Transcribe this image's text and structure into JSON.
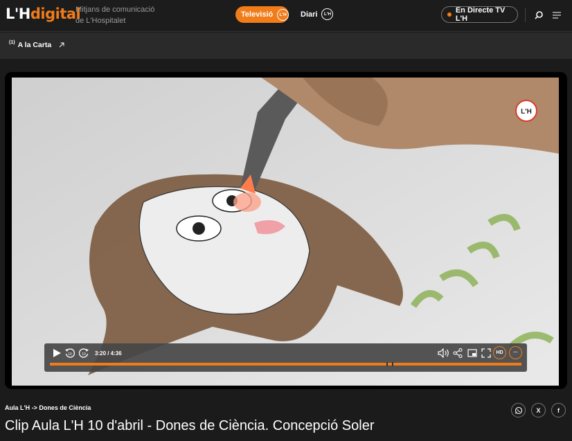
{
  "header": {
    "logo_lh": "L'H",
    "logo_digital": "digital",
    "tagline_line1": "Mitjans de comunicació",
    "tagline_line2": "de L'Hospitalet",
    "tv_label": "Televisió",
    "tv_badge": "L'H",
    "diari_label": "Diari",
    "diari_badge": "L'H",
    "live_label": "En Directe TV L'H",
    "icons": [
      "search-icon",
      "menu-icon"
    ],
    "accent_color": "#f07c1a"
  },
  "subnav": {
    "carta_sup": "(1)",
    "carta_label": "A la Carta",
    "carta_icon": "arrow-up-right-icon"
  },
  "player": {
    "watermark": "L'H",
    "time": "3:20 / 4:36",
    "progress_fraction": 0.725,
    "buffer_mark_fraction": 0.713,
    "hd_label": "HD",
    "more_label": "···",
    "controls": [
      "play-icon",
      "rewind-10-icon",
      "forward-10-icon",
      "volume-icon",
      "share-icon",
      "pip-icon",
      "fullscreen-icon"
    ]
  },
  "article": {
    "breadcrumb": "Aula L'H -> Dones de Ciència",
    "title": "Clip Aula L'H 10 d'abril - Dones de Ciència. Concepció Soler",
    "share_icons": [
      "whatsapp-icon",
      "x-icon",
      "facebook-icon"
    ],
    "x_label": "X",
    "fb_label": "f"
  }
}
